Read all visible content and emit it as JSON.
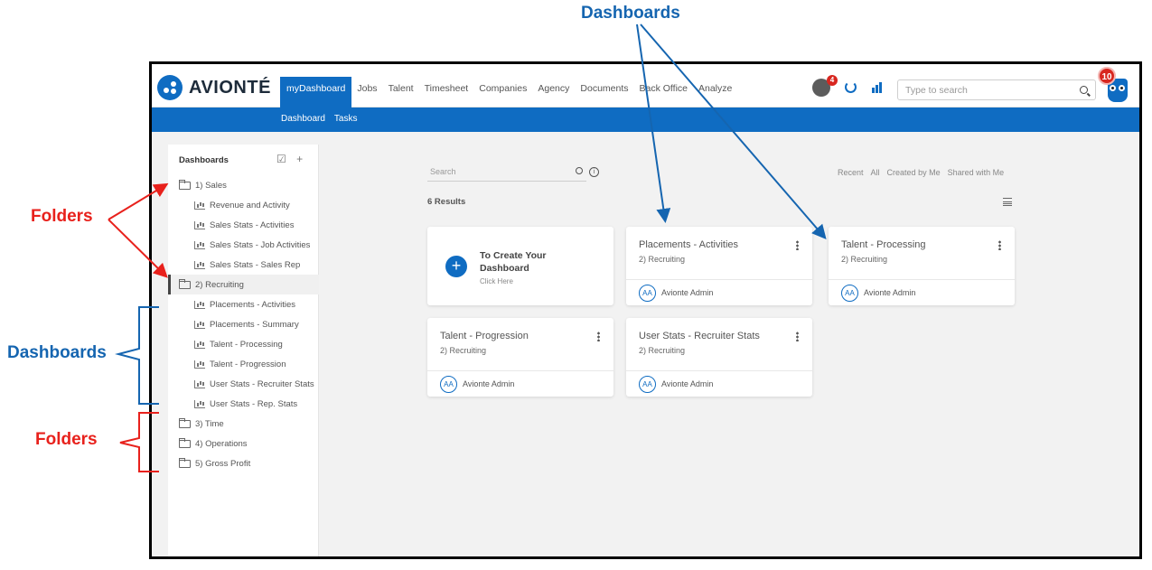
{
  "annotations": {
    "top_label": "Dashboards",
    "left_folders_1": "Folders",
    "left_dashboards": "Dashboards",
    "left_folders_2": "Folders"
  },
  "colors": {
    "brand": "#0f6cc2",
    "annotation_red": "#e8211c",
    "annotation_blue": "#1565b0",
    "badge": "#d8261f"
  },
  "header": {
    "logo_text": "AVIONTÉ",
    "nav": [
      "myDashboard",
      "Jobs",
      "Talent",
      "Timesheet",
      "Companies",
      "Agency",
      "Documents",
      "Back Office",
      "Analyze"
    ],
    "active_nav": "myDashboard",
    "notification_count": "4",
    "owl_badge_count": "10",
    "search_placeholder": "Type to search",
    "icons": [
      "avatar",
      "refresh-icon",
      "analytics-icon",
      "search-icon",
      "owl-icon"
    ]
  },
  "subnav": [
    "Dashboard",
    "Tasks"
  ],
  "sidebar": {
    "title": "Dashboards",
    "items": [
      {
        "label": "1) Sales",
        "type": "folder"
      },
      {
        "label": "Revenue and Activity",
        "type": "dashboard"
      },
      {
        "label": "Sales Stats - Activities",
        "type": "dashboard"
      },
      {
        "label": "Sales Stats - Job Activities",
        "type": "dashboard"
      },
      {
        "label": "Sales Stats - Sales Rep",
        "type": "dashboard"
      },
      {
        "label": "2) Recruiting",
        "type": "folder",
        "selected": true
      },
      {
        "label": "Placements - Activities",
        "type": "dashboard"
      },
      {
        "label": "Placements - Summary",
        "type": "dashboard"
      },
      {
        "label": "Talent - Processing",
        "type": "dashboard"
      },
      {
        "label": "Talent - Progression",
        "type": "dashboard"
      },
      {
        "label": "User Stats - Recruiter Stats",
        "type": "dashboard"
      },
      {
        "label": "User Stats - Rep. Stats",
        "type": "dashboard"
      },
      {
        "label": "3) Time",
        "type": "folder"
      },
      {
        "label": "4) Operations",
        "type": "folder"
      },
      {
        "label": "5) Gross Profit",
        "type": "folder"
      }
    ]
  },
  "main": {
    "search_placeholder": "Search",
    "filters": [
      "Recent",
      "All",
      "Created by Me",
      "Shared with Me"
    ],
    "results_text": "6 Results",
    "create_card": {
      "title": "To Create Your Dashboard",
      "subtitle": "Click Here",
      "plus": "+"
    },
    "cards": [
      {
        "title": "Placements - Activities",
        "folder": "2) Recruiting",
        "initials": "AA",
        "owner": "Avionte Admin"
      },
      {
        "title": "Talent - Processing",
        "folder": "2) Recruiting",
        "initials": "AA",
        "owner": "Avionte Admin"
      },
      {
        "title": "Talent - Progression",
        "folder": "2) Recruiting",
        "initials": "AA",
        "owner": "Avionte Admin"
      },
      {
        "title": "User Stats - Recruiter Stats",
        "folder": "2) Recruiting",
        "initials": "AA",
        "owner": "Avionte Admin"
      }
    ]
  }
}
